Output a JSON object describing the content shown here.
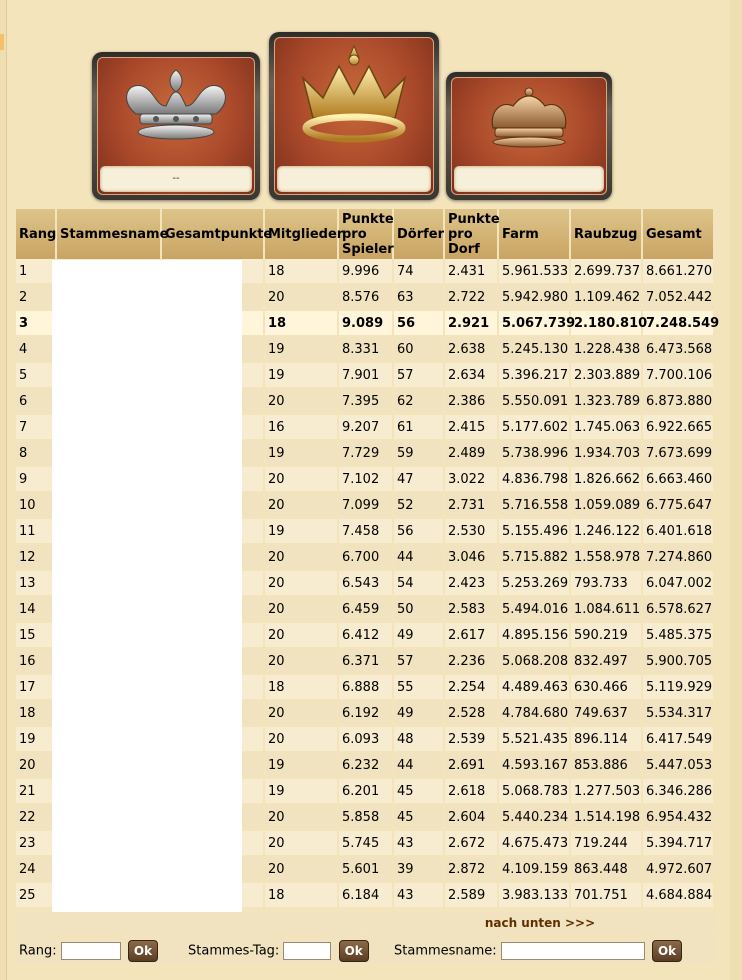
{
  "podium": {
    "first_name": "",
    "second_name": "--",
    "third_name": ""
  },
  "columns": [
    "Rang",
    "Stammesname",
    "Gesamtpunkte",
    "Mitglieder",
    "Punkte pro Spieler",
    "Dörfer",
    "Punkte pro Dorf",
    "Farm",
    "Raubzug",
    "Gesamt"
  ],
  "rows": [
    [
      "1",
      "",
      "",
      "18",
      "9.996",
      "74",
      "2.431",
      "5.961.533",
      "2.699.737",
      "8.661.270"
    ],
    [
      "2",
      "",
      "",
      "20",
      "8.576",
      "63",
      "2.722",
      "5.942.980",
      "1.109.462",
      "7.052.442"
    ],
    [
      "3",
      "",
      "",
      "18",
      "9.089",
      "56",
      "2.921",
      "5.067.739",
      "2.180.810",
      "7.248.549"
    ],
    [
      "4",
      "",
      "",
      "19",
      "8.331",
      "60",
      "2.638",
      "5.245.130",
      "1.228.438",
      "6.473.568"
    ],
    [
      "5",
      "",
      "",
      "19",
      "7.901",
      "57",
      "2.634",
      "5.396.217",
      "2.303.889",
      "7.700.106"
    ],
    [
      "6",
      "",
      "",
      "20",
      "7.395",
      "62",
      "2.386",
      "5.550.091",
      "1.323.789",
      "6.873.880"
    ],
    [
      "7",
      "",
      "",
      "16",
      "9.207",
      "61",
      "2.415",
      "5.177.602",
      "1.745.063",
      "6.922.665"
    ],
    [
      "8",
      "",
      "",
      "19",
      "7.729",
      "59",
      "2.489",
      "5.738.996",
      "1.934.703",
      "7.673.699"
    ],
    [
      "9",
      "",
      "",
      "20",
      "7.102",
      "47",
      "3.022",
      "4.836.798",
      "1.826.662",
      "6.663.460"
    ],
    [
      "10",
      "",
      "",
      "20",
      "7.099",
      "52",
      "2.731",
      "5.716.558",
      "1.059.089",
      "6.775.647"
    ],
    [
      "11",
      "",
      "",
      "19",
      "7.458",
      "56",
      "2.530",
      "5.155.496",
      "1.246.122",
      "6.401.618"
    ],
    [
      "12",
      "",
      "",
      "20",
      "6.700",
      "44",
      "3.046",
      "5.715.882",
      "1.558.978",
      "7.274.860"
    ],
    [
      "13",
      "",
      "",
      "20",
      "6.543",
      "54",
      "2.423",
      "5.253.269",
      "793.733",
      "6.047.002"
    ],
    [
      "14",
      "",
      "",
      "20",
      "6.459",
      "50",
      "2.583",
      "5.494.016",
      "1.084.611",
      "6.578.627"
    ],
    [
      "15",
      "",
      "",
      "20",
      "6.412",
      "49",
      "2.617",
      "4.895.156",
      "590.219",
      "5.485.375"
    ],
    [
      "16",
      "",
      "",
      "20",
      "6.371",
      "57",
      "2.236",
      "5.068.208",
      "832.497",
      "5.900.705"
    ],
    [
      "17",
      "",
      "",
      "18",
      "6.888",
      "55",
      "2.254",
      "4.489.463",
      "630.466",
      "5.119.929"
    ],
    [
      "18",
      "",
      "",
      "20",
      "6.192",
      "49",
      "2.528",
      "4.784.680",
      "749.637",
      "5.534.317"
    ],
    [
      "19",
      "",
      "",
      "20",
      "6.093",
      "48",
      "2.539",
      "5.521.435",
      "896.114",
      "6.417.549"
    ],
    [
      "20",
      "",
      "",
      "19",
      "6.232",
      "44",
      "2.691",
      "4.593.167",
      "853.886",
      "5.447.053"
    ],
    [
      "21",
      "",
      "",
      "19",
      "6.201",
      "45",
      "2.618",
      "5.068.783",
      "1.277.503",
      "6.346.286"
    ],
    [
      "22",
      "",
      "",
      "20",
      "5.858",
      "45",
      "2.604",
      "5.440.234",
      "1.514.198",
      "6.954.432"
    ],
    [
      "23",
      "",
      "",
      "20",
      "5.745",
      "43",
      "2.672",
      "4.675.473",
      "719.244",
      "5.394.717"
    ],
    [
      "24",
      "",
      "",
      "20",
      "5.601",
      "39",
      "2.872",
      "4.109.159",
      "863.448",
      "4.972.607"
    ],
    [
      "25",
      "",
      "",
      "18",
      "6.184",
      "43",
      "2.589",
      "3.983.133",
      "701.751",
      "4.684.884"
    ]
  ],
  "own_row_index": 2,
  "nav": {
    "down_link": "nach unten >>>"
  },
  "search": {
    "rank_label": "Rang:",
    "tag_label": "Stammes-Tag:",
    "name_label": "Stammesname:",
    "ok": "Ok"
  }
}
